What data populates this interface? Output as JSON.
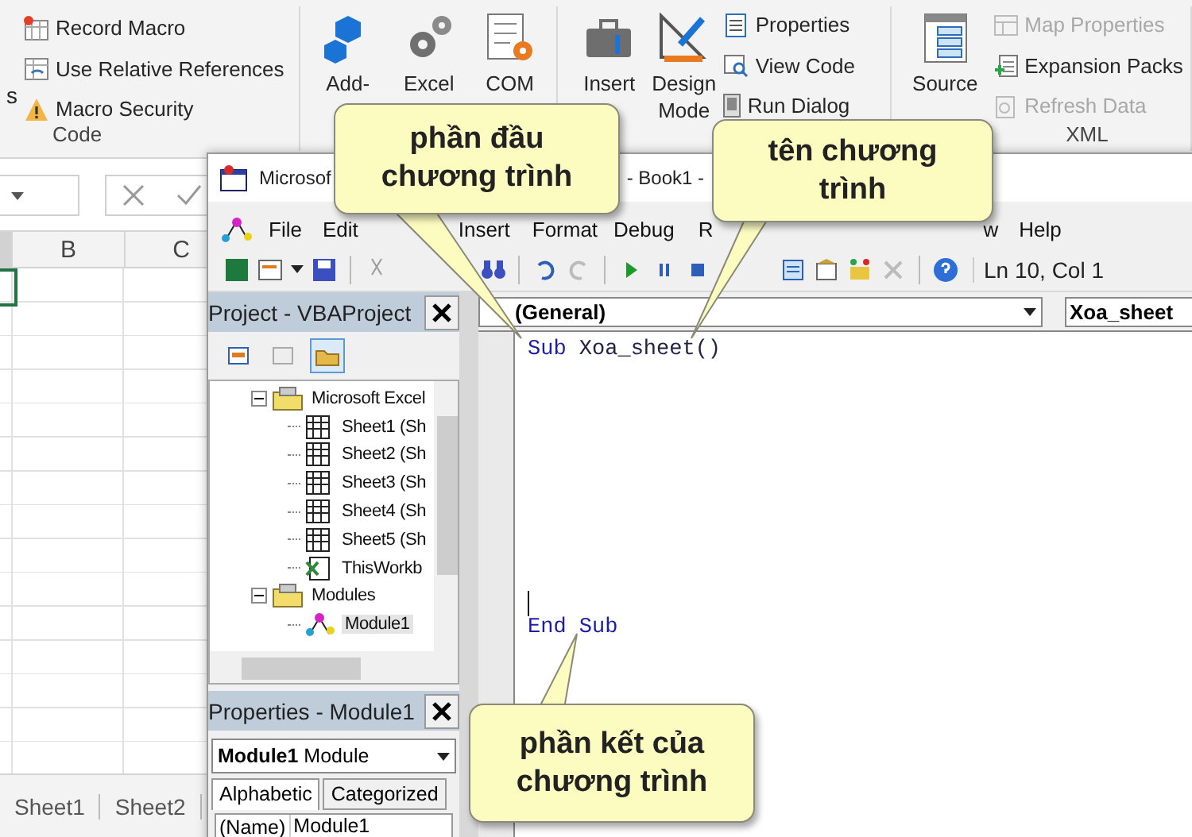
{
  "ribbon": {
    "code_group": {
      "cut_text": "s",
      "label": "Code",
      "commands": [
        {
          "label": "Record Macro"
        },
        {
          "label": "Use Relative References"
        },
        {
          "label": "Macro Security"
        }
      ]
    },
    "addins_group": {
      "buttons": [
        {
          "label": "Add-"
        },
        {
          "label": "Excel"
        },
        {
          "label": "COM"
        }
      ]
    },
    "controls_group": {
      "buttons": [
        {
          "label": "Insert"
        },
        {
          "label": "Design Mode"
        }
      ],
      "commands": [
        {
          "label": "Properties"
        },
        {
          "label": "View Code"
        },
        {
          "label": "Run Dialog"
        }
      ]
    },
    "xml_group": {
      "label": "XML",
      "buttons": [
        {
          "label": "Source"
        }
      ],
      "commands": [
        {
          "label": "Map Properties",
          "disabled": true
        },
        {
          "label": "Expansion Packs",
          "disabled": false
        },
        {
          "label": "Refresh Data",
          "disabled": true
        }
      ]
    }
  },
  "sheet": {
    "columns": [
      "B",
      "C"
    ],
    "tabs": [
      {
        "label": "Sheet1"
      },
      {
        "label": "Sheet2"
      }
    ]
  },
  "vba_window": {
    "title_parts": [
      "Microsof",
      "- Book1 -"
    ],
    "menu": [
      "File",
      "Edit",
      "Insert",
      "Format",
      "Debug",
      "R",
      "w",
      "Help"
    ],
    "position": "Ln 10, Col 1",
    "project": {
      "title": "Project - VBAProject",
      "tree": [
        {
          "label": "Microsoft Excel",
          "kind": "folder",
          "expanded": true,
          "selected": false,
          "children": [
            {
              "label": "Sheet1 (Sh",
              "kind": "sheet",
              "selected": false
            },
            {
              "label": "Sheet2 (Sh",
              "kind": "sheet",
              "selected": false
            },
            {
              "label": "Sheet3 (Sh",
              "kind": "sheet",
              "selected": false
            },
            {
              "label": "Sheet4 (Sh",
              "kind": "sheet",
              "selected": false
            },
            {
              "label": "Sheet5 (Sh",
              "kind": "sheet",
              "selected": false
            },
            {
              "label": "ThisWorkb",
              "kind": "workbook",
              "selected": false
            }
          ]
        },
        {
          "label": "Modules",
          "kind": "folder",
          "expanded": true,
          "selected": false,
          "children": [
            {
              "label": "Module1",
              "kind": "module",
              "selected": true
            }
          ]
        }
      ]
    },
    "properties": {
      "title": "Properties - Module1",
      "object": "**Module1** Module",
      "tabs": [
        {
          "label": "Alphabetic",
          "selected": true
        },
        {
          "label": "Categorized",
          "selected": false
        }
      ],
      "rows": [
        {
          "name": "(Name)",
          "value": "Module1"
        }
      ]
    },
    "code": {
      "scope": "(General)",
      "procedure": "Xoa_sheet",
      "first_line": {
        "keyword": "Sub",
        "name": " Xoa_sheet()"
      },
      "last_line": "End Sub"
    }
  },
  "callouts": [
    {
      "text": "phần đầu chương trình"
    },
    {
      "text": "tên chương trình"
    },
    {
      "text": "phần kết của chương trình"
    }
  ]
}
